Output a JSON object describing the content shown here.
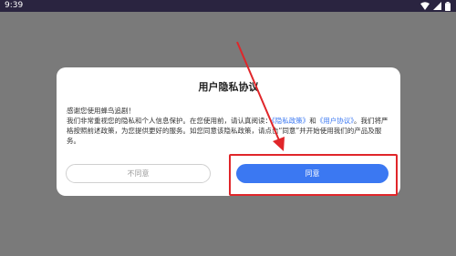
{
  "status_bar": {
    "time": "9:39",
    "icons": [
      "wifi-icon",
      "signal-icon",
      "battery-icon"
    ]
  },
  "dialog": {
    "title": "用户隐私协议",
    "greeting": "感谢您使用蜂鸟追剧！",
    "text_1": "我们非常重视您的隐私和个人信息保护。在您使用前，请认真阅读：",
    "privacy_link": "《隐私政策》",
    "and": "和",
    "user_link": "《用户协议》",
    "text_2": "。我们将严格按照前述政策，为您提供更好的服务。如您同意该隐私政策，请点击“同意”并开始使用我们的产品及服务。",
    "disagree_label": "不同意",
    "agree_label": "同意"
  },
  "colors": {
    "accent": "#3b78f2",
    "annotation": "#e0262a",
    "overlay": "#7a7a7a"
  }
}
